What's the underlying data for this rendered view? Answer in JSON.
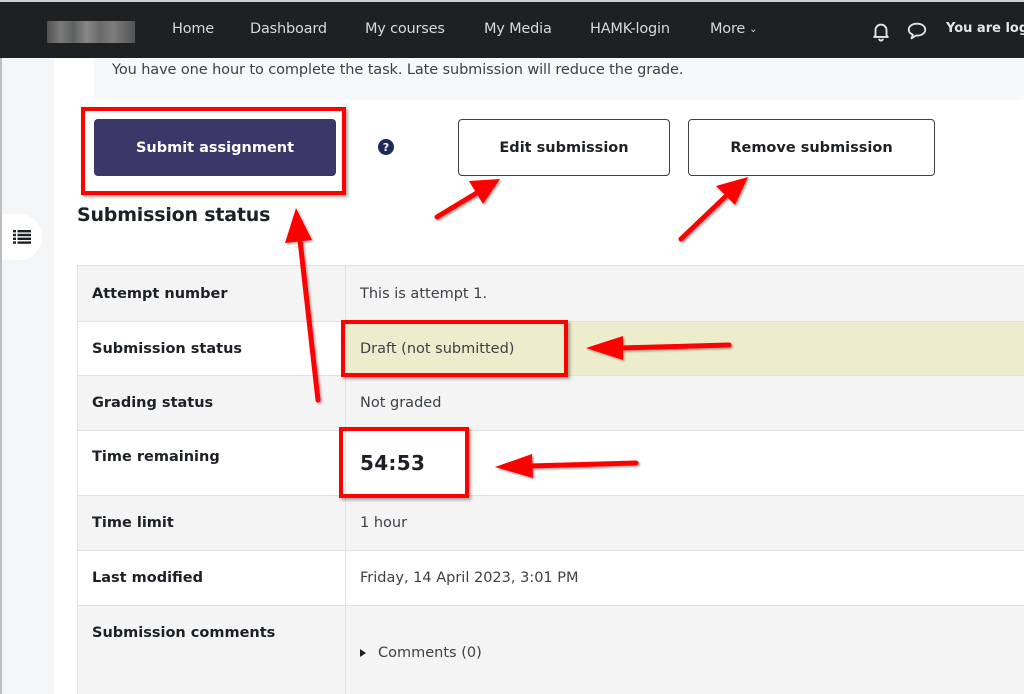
{
  "navbar": {
    "logo_alt": "Site logo (blurred)",
    "items": [
      {
        "label": "Home"
      },
      {
        "label": "Dashboard"
      },
      {
        "label": "My courses"
      },
      {
        "label": "My Media"
      },
      {
        "label": "HAMK-login"
      },
      {
        "label": "More",
        "icon": "chevron-down-icon"
      }
    ],
    "icons": [
      "bell-icon",
      "chat-bubble-icon"
    ],
    "user_text": "You are logg"
  },
  "drawer": {
    "icon": "list-icon"
  },
  "notice": {
    "text": "You have one hour to complete the task. Late submission will reduce the grade."
  },
  "actions": {
    "submit_label": "Submit assignment",
    "help_glyph": "?",
    "edit_label": "Edit submission",
    "remove_label": "Remove submission"
  },
  "submission_status": {
    "heading": "Submission status",
    "rows": [
      {
        "label": "Attempt number",
        "value": "This is attempt 1."
      },
      {
        "label": "Submission status",
        "value": "Draft (not submitted)"
      },
      {
        "label": "Grading status",
        "value": "Not graded"
      },
      {
        "label": "Time remaining",
        "value": "54:53"
      },
      {
        "label": "Time limit",
        "value": "1 hour"
      },
      {
        "label": "Last modified",
        "value": "Friday, 14 April 2023, 3:01 PM"
      },
      {
        "label": "Submission comments",
        "value": "Comments (0)"
      }
    ]
  },
  "annotations": {
    "color": "#ff0000"
  }
}
